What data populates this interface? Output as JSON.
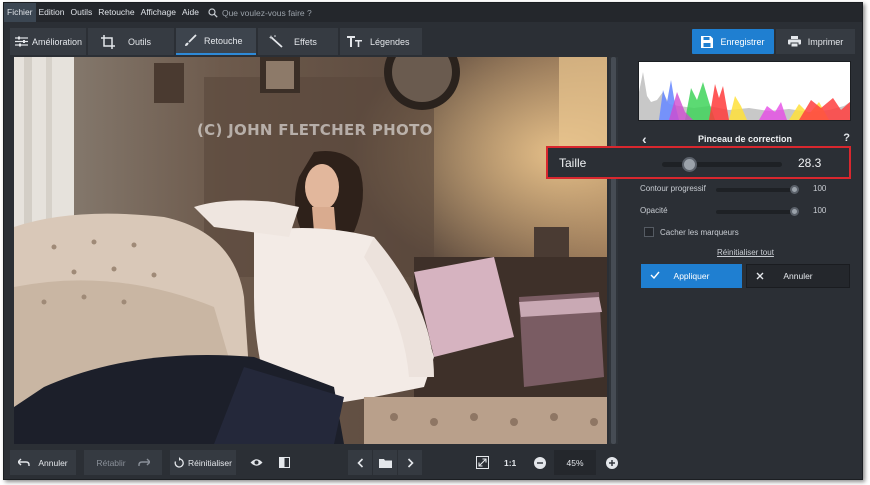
{
  "menu": {
    "items": [
      "Fichier",
      "Edition",
      "Outils",
      "Retouche",
      "Affichage",
      "Aide"
    ],
    "search_placeholder": "Que voulez-vous faire ?"
  },
  "toolbar": {
    "tabs": [
      {
        "label": "Amélioration",
        "icon": "sliders-icon"
      },
      {
        "label": "Outils",
        "icon": "crop-icon"
      },
      {
        "label": "Retouche",
        "icon": "brush-icon",
        "active": true
      },
      {
        "label": "Effets",
        "icon": "magic-wand-icon"
      },
      {
        "label": "Légendes",
        "icon": "text-icon"
      }
    ],
    "save_label": "Enregistrer",
    "print_label": "Imprimer"
  },
  "photo": {
    "watermark": "(C) JOHN FLETCHER PHOTO"
  },
  "bottom": {
    "undo_label": "Annuler",
    "redo_label": "Rétablir",
    "reset_label": "Réinitialiser",
    "ratio_label": "1:1",
    "zoom": "45%"
  },
  "panel": {
    "title": "Pinceau de correction",
    "help": "?",
    "size_label": "Taille",
    "size_value": "28.3",
    "size_fraction": 0.23,
    "feather_label": "Contour progressif",
    "feather_value": "100",
    "opacity_label": "Opacité",
    "opacity_value": "100",
    "hide_markers_label": "Cacher les marqueurs",
    "reset_all_label": "Réinitialiser tout",
    "apply_label": "Appliquer",
    "cancel_label": "Annuler"
  },
  "colors": {
    "accent": "#1f7fd1",
    "highlight": "#d9272e",
    "background": "#2b2f35"
  }
}
